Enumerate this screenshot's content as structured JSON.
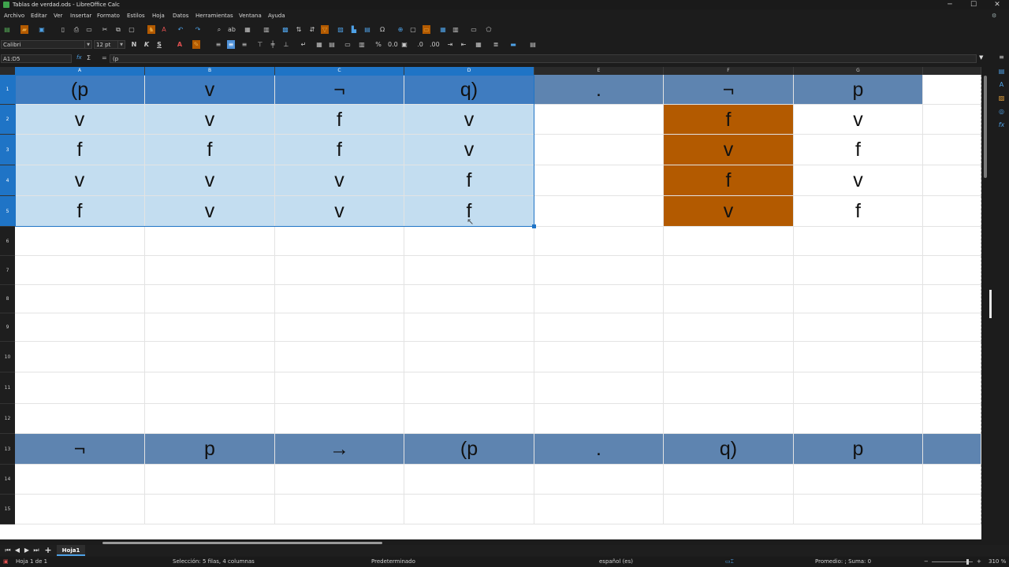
{
  "window": {
    "title": "Tablas de verdad.ods - LibreOffice Calc",
    "minimize": "─",
    "maximize": "☐",
    "close": "✕"
  },
  "menu": [
    "Archivo",
    "Editar",
    "Ver",
    "Insertar",
    "Formato",
    "Estilos",
    "Hoja",
    "Datos",
    "Herramientas",
    "Ventana",
    "Ayuda"
  ],
  "format_toolbar": {
    "font_name": "Calibri",
    "font_size": "12 pt",
    "bold": "N",
    "italic": "K",
    "underline": "S",
    "strikethrough": "S"
  },
  "formula_bar": {
    "name_box": "A1:D5",
    "fx": "fx",
    "sigma": "Σ",
    "equals": "=",
    "content": "(p"
  },
  "columns": [
    "A",
    "B",
    "C",
    "D",
    "E",
    "F",
    "G"
  ],
  "rows": [
    "1",
    "2",
    "3",
    "4",
    "5",
    "6",
    "7",
    "8",
    "9",
    "10",
    "11",
    "12",
    "13",
    "14",
    "15"
  ],
  "cells": {
    "row1": [
      "(p",
      "v",
      "¬",
      "q)",
      ".",
      "¬",
      "p"
    ],
    "row2": [
      "v",
      "v",
      "f",
      "v",
      "",
      "f",
      "v"
    ],
    "row3": [
      "f",
      "f",
      "f",
      "v",
      "",
      "v",
      "f"
    ],
    "row4": [
      "v",
      "v",
      "v",
      "f",
      "",
      "f",
      "v"
    ],
    "row5": [
      "f",
      "v",
      "v",
      "f",
      "",
      "v",
      "f"
    ],
    "row13": [
      "¬",
      "p",
      "→",
      "(p",
      ".",
      "q)",
      "p"
    ]
  },
  "colors": {
    "header_row_blue": "#5e84b0",
    "selection_fill": "#c3ddf0",
    "orange_column": "#b35a00",
    "accent": "#1f74c6"
  },
  "sheet_tab": "Hoja1",
  "status": {
    "sheet": "Hoja 1 de 1",
    "selection": "Selección: 5 filas, 4 columnas",
    "style": "Predeterminado",
    "language": "español (es)",
    "sum": "Promedio: ; Suma: 0",
    "zoom": "310 %"
  }
}
